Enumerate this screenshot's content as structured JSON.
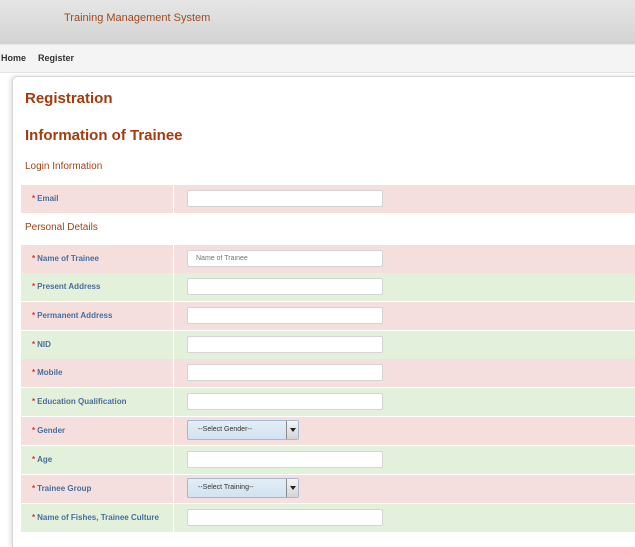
{
  "header": {
    "app_title": "Training Management System"
  },
  "nav": {
    "items": [
      {
        "label": "Home"
      },
      {
        "label": "Register"
      }
    ]
  },
  "page": {
    "title": "Registration",
    "subtitle": "Information of Trainee",
    "sections": {
      "login": "Login Information",
      "personal": "Personal Details"
    }
  },
  "required_marker": "*",
  "fields": {
    "email": {
      "label": "Email",
      "value": "",
      "placeholder": ""
    },
    "name": {
      "label": "Name of Trainee",
      "value": "",
      "placeholder": "Name of Trainee"
    },
    "present_address": {
      "label": "Present Address",
      "value": "",
      "placeholder": ""
    },
    "permanent_address": {
      "label": "Permanent Address",
      "value": "",
      "placeholder": ""
    },
    "nid": {
      "label": "NID",
      "value": "",
      "placeholder": ""
    },
    "mobile": {
      "label": "Mobile",
      "value": "",
      "placeholder": ""
    },
    "education": {
      "label": "Education Qualification",
      "value": "",
      "placeholder": ""
    },
    "gender": {
      "label": "Gender",
      "selected": "--Select Gender--"
    },
    "age": {
      "label": "Age",
      "value": "",
      "placeholder": ""
    },
    "trainee_group": {
      "label": "Trainee Group",
      "selected": "--Select Training--"
    },
    "fishes_culture": {
      "label": "Name of Fishes, Trainee Culture",
      "value": "",
      "placeholder": ""
    }
  },
  "colors": {
    "row_pink": "#f4dede",
    "row_green": "#e2f0dc",
    "heading": "#a33b0f",
    "label_blue": "#4a6e9a",
    "required": "#e03030"
  }
}
